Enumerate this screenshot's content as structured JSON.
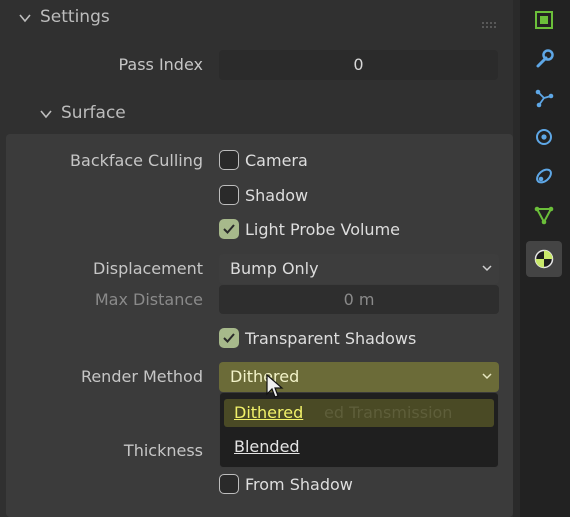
{
  "settings": {
    "title": "Settings"
  },
  "pass_index": {
    "label": "Pass Index",
    "value": "0"
  },
  "surface": {
    "title": "Surface",
    "backface_culling": {
      "label": "Backface Culling",
      "options": [
        {
          "label": "Camera",
          "checked": false
        },
        {
          "label": "Shadow",
          "checked": false
        },
        {
          "label": "Light Probe Volume",
          "checked": true
        }
      ]
    },
    "displacement": {
      "label": "Displacement",
      "value": "Bump Only"
    },
    "max_distance": {
      "label": "Max Distance",
      "value": "0 m"
    },
    "transparent_shadows": {
      "label": "Transparent Shadows",
      "checked": true
    },
    "render_method": {
      "label": "Render Method",
      "value": "Dithered",
      "options": [
        "Dithered",
        "Blended"
      ],
      "hidden_behind": "ed Transmission"
    },
    "thickness": {
      "label": "Thickness"
    },
    "from_shadow": {
      "label": "From Shadow",
      "checked": false
    }
  },
  "tabs": [
    {
      "name": "object-tab",
      "icon": "object-icon"
    },
    {
      "name": "modifiers-tab",
      "icon": "wrench-icon"
    },
    {
      "name": "particles-tab",
      "icon": "particles-icon"
    },
    {
      "name": "physics-tab",
      "icon": "physics-icon"
    },
    {
      "name": "constraints-tab",
      "icon": "constraints-icon"
    },
    {
      "name": "data-tab",
      "icon": "data-icon"
    },
    {
      "name": "material-tab",
      "icon": "material-icon",
      "active": true
    }
  ],
  "colors": {
    "accent_check": "#a7b98b",
    "popup_highlight": "#4a4a25",
    "selected_text": "#f2f26a"
  }
}
